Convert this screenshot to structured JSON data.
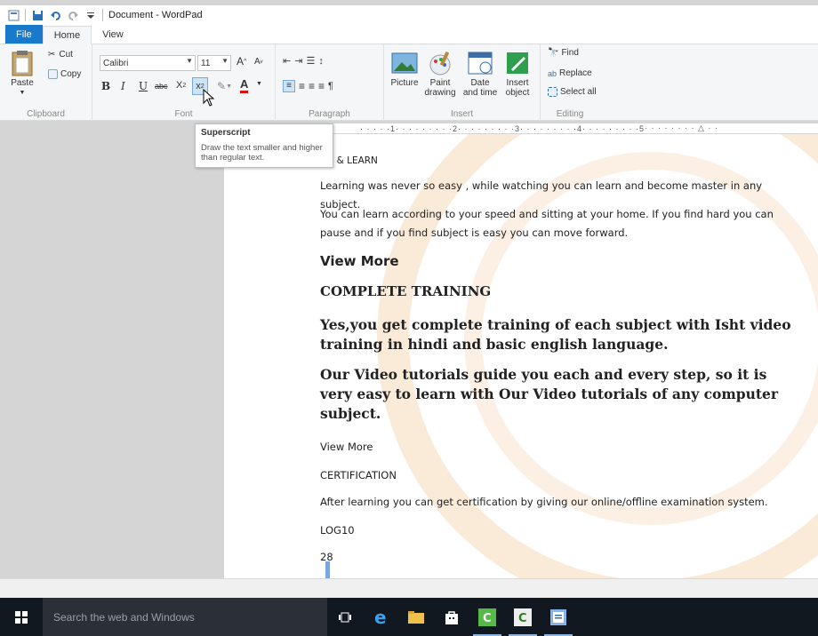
{
  "window": {
    "title": "Document - WordPad",
    "quick_access": [
      "save-icon",
      "undo-icon",
      "redo-icon",
      "customize-icon"
    ]
  },
  "tabs": [
    {
      "label": "File"
    },
    {
      "label": "Home"
    },
    {
      "label": "View"
    }
  ],
  "ribbon": {
    "clipboard": {
      "label": "Clipboard",
      "paste": "Paste",
      "cut": "Cut",
      "copy": "Copy"
    },
    "font": {
      "label": "Font",
      "family": "Calibri",
      "size": "11",
      "bold": "B",
      "italic": "I",
      "underline": "U",
      "strike": "abc"
    },
    "paragraph": {
      "label": "Paragraph"
    },
    "insert": {
      "label": "Insert",
      "picture": "Picture",
      "paint": "Paint drawing",
      "datetime": "Date and time",
      "object": "Insert object"
    },
    "editing": {
      "label": "Editing",
      "find": "Find",
      "replace": "Replace",
      "select_all": "Select all"
    }
  },
  "ruler": {
    "marks": [
      "1",
      "2",
      "3",
      "4",
      "5"
    ]
  },
  "tooltip": {
    "title": "Superscript",
    "description": "Draw the text smaller and higher than regular text."
  },
  "document": {
    "partial_heading": "CH & LEARN",
    "para1": "Learning was never so easy , while watching you can learn and become master in any subject.",
    "para2": "You can learn according to your speed and sitting at your home. If you find hard you can pause and if you find subject is easy you can move forward.",
    "view_more_1": "View More",
    "complete_training": "COMPLETE TRAINING",
    "big1": "Yes,you get complete training of each subject with Isht video training in hindi and basic english language.",
    "big2": "Our Video tutorials guide you each and every step, so it is very easy to learn with Our Video tutorials of any computer subject.",
    "view_more_2": "View More",
    "certification": "CERTIFICATION",
    "cert_text": "After learning you can get certification by giving our online/offline examination system.",
    "log": "LOG10",
    "num": "28"
  },
  "taskbar": {
    "search_placeholder": "Search the web and Windows"
  },
  "colors": {
    "accent": "#1979ca",
    "taskbar": "#111820"
  }
}
